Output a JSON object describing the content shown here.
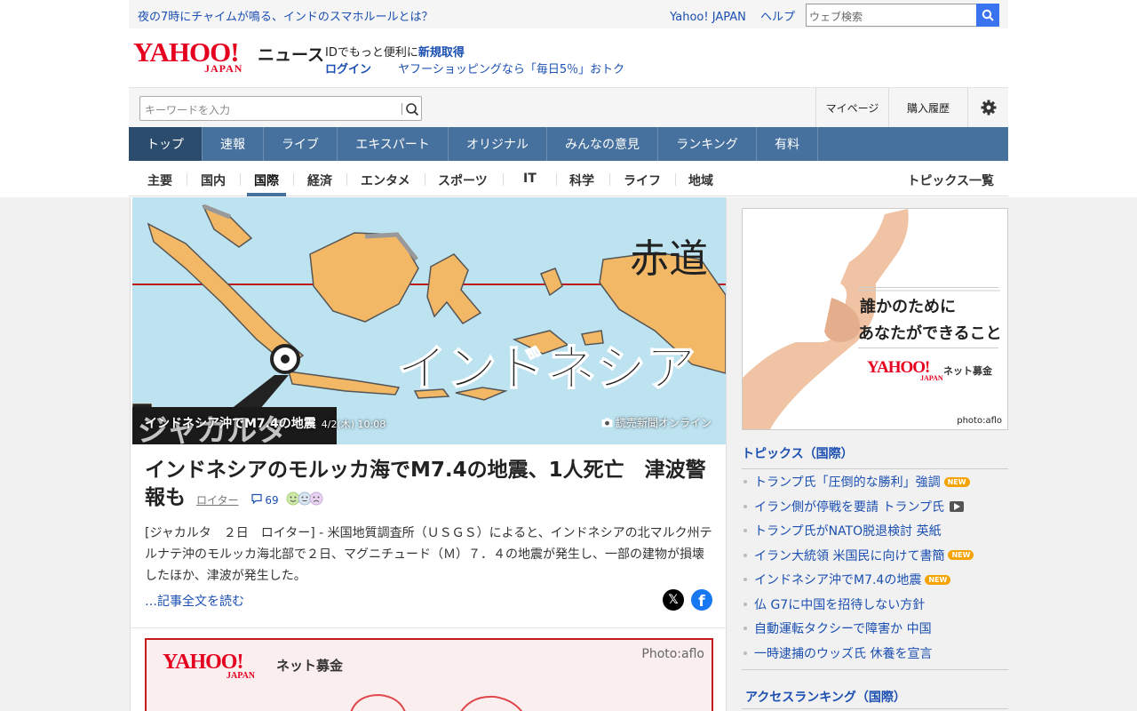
{
  "util": {
    "promo": "夜の7時にチャイムが鳴る、インドのスマホルールとは？",
    "yahoo_japan": "Yahoo! JAPAN",
    "help": "ヘルプ",
    "web_search_placeholder": "ウェブ検索"
  },
  "masthead": {
    "logo": "YAHOO!",
    "logo_sub": "JAPAN",
    "service": "ニュース",
    "promo_prefix": "IDでもっと便利に",
    "promo_signup": "新規取得",
    "login": "ログイン",
    "shopping": "ヤフーショッピングなら「毎日5％」おトク"
  },
  "search": {
    "placeholder": "キーワードを入力",
    "mypage": "マイページ",
    "history": "購入履歴"
  },
  "main_nav": [
    "トップ",
    "速報",
    "ライブ",
    "エキスパート",
    "オリジナル",
    "みんなの意見",
    "ランキング",
    "有料"
  ],
  "sub_nav": [
    "主要",
    "国内",
    "国際",
    "経済",
    "エンタメ",
    "スポーツ",
    "IT",
    "科学",
    "ライフ",
    "地域"
  ],
  "sub_nav_active": "国際",
  "topics_all": "トピックス一覧",
  "hero": {
    "map_label_equator": "赤道",
    "map_label_country": "インドネシア",
    "map_label_city": "ジャカルタ",
    "caption": "インドネシア沖でM7.4の地震",
    "date": "4/2(木) 10:08",
    "credit": "読売新聞オンライン"
  },
  "article": {
    "title": "インドネシアのモルッカ海でM7.4の地震、1人死亡　津波警報も",
    "source": "ロイター",
    "comments": "69",
    "body": "[ジャカルタ　２日　ロイター] - 米国地質調査所（ＵＳＧＳ）によると、インドネシアの北マルク州テルナテ沖のモルッカ海北部で２日、マグニチュード（Ｍ）７．４の地震が発生し、一部の建物が損壊したほか、津波が発生した。",
    "read_more": "…記事全文を読む"
  },
  "banner2": {
    "logo": "YAHOO!",
    "logo_sub": "JAPAN",
    "service": "ネット募金",
    "credit": "Photo:aflo"
  },
  "ad": {
    "line1": "誰かのために",
    "line2": "あなたができること",
    "logo": "YAHOO!",
    "logo_sub": "JAPAN",
    "service": "ネット募金",
    "credit": "photo:aflo"
  },
  "topics": {
    "heading": "トピックス（国際）",
    "new_badge": "NEW",
    "items": [
      {
        "text": "トランプ氏「圧倒的な勝利」強調",
        "new": true,
        "video": false
      },
      {
        "text": "イラン側が停戦を要請 トランプ氏",
        "new": false,
        "video": true
      },
      {
        "text": "トランプ氏がNATO脱退検討 英紙",
        "new": false,
        "video": false
      },
      {
        "text": "イラン大統領 米国民に向けて書簡",
        "new": true,
        "video": false
      },
      {
        "text": "インドネシア沖でM7.4の地震",
        "new": true,
        "video": false
      },
      {
        "text": "仏 G7に中国を招待しない方針",
        "new": false,
        "video": false
      },
      {
        "text": "自動運転タクシーで障害か 中国",
        "new": false,
        "video": false
      },
      {
        "text": "一時逮捕のウッズ氏 休養を宣言",
        "new": false,
        "video": false
      }
    ]
  },
  "ranking": {
    "heading": "アクセスランキング（国際）"
  },
  "colors": {
    "nav_bg": "#46709d",
    "nav_active": "#2c4c6d",
    "link": "#1b4fb1",
    "brand_red": "#e6001f",
    "badge_new": "#f5a300"
  }
}
